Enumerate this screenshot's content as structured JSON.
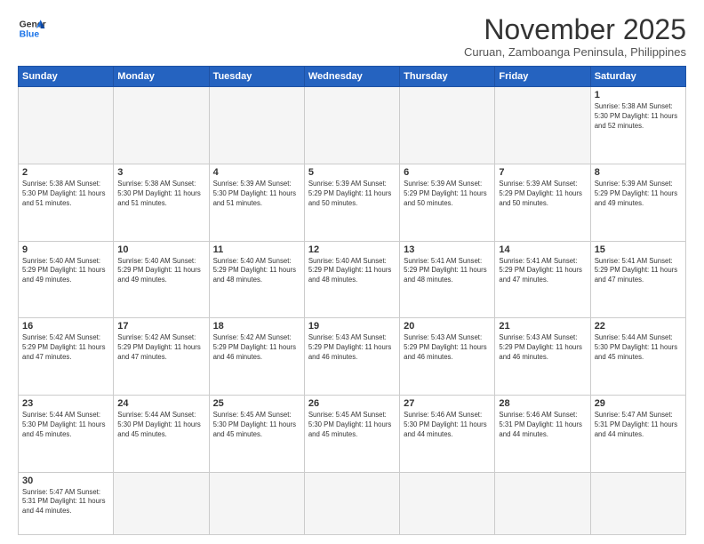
{
  "header": {
    "logo_line1": "General",
    "logo_line2": "Blue",
    "month_title": "November 2025",
    "subtitle": "Curuan, Zamboanga Peninsula, Philippines"
  },
  "days_of_week": [
    "Sunday",
    "Monday",
    "Tuesday",
    "Wednesday",
    "Thursday",
    "Friday",
    "Saturday"
  ],
  "weeks": [
    [
      {
        "day": "",
        "info": ""
      },
      {
        "day": "",
        "info": ""
      },
      {
        "day": "",
        "info": ""
      },
      {
        "day": "",
        "info": ""
      },
      {
        "day": "",
        "info": ""
      },
      {
        "day": "",
        "info": ""
      },
      {
        "day": "1",
        "info": "Sunrise: 5:38 AM\nSunset: 5:30 PM\nDaylight: 11 hours\nand 52 minutes."
      }
    ],
    [
      {
        "day": "2",
        "info": "Sunrise: 5:38 AM\nSunset: 5:30 PM\nDaylight: 11 hours\nand 51 minutes."
      },
      {
        "day": "3",
        "info": "Sunrise: 5:38 AM\nSunset: 5:30 PM\nDaylight: 11 hours\nand 51 minutes."
      },
      {
        "day": "4",
        "info": "Sunrise: 5:39 AM\nSunset: 5:30 PM\nDaylight: 11 hours\nand 51 minutes."
      },
      {
        "day": "5",
        "info": "Sunrise: 5:39 AM\nSunset: 5:29 PM\nDaylight: 11 hours\nand 50 minutes."
      },
      {
        "day": "6",
        "info": "Sunrise: 5:39 AM\nSunset: 5:29 PM\nDaylight: 11 hours\nand 50 minutes."
      },
      {
        "day": "7",
        "info": "Sunrise: 5:39 AM\nSunset: 5:29 PM\nDaylight: 11 hours\nand 50 minutes."
      },
      {
        "day": "8",
        "info": "Sunrise: 5:39 AM\nSunset: 5:29 PM\nDaylight: 11 hours\nand 49 minutes."
      }
    ],
    [
      {
        "day": "9",
        "info": "Sunrise: 5:40 AM\nSunset: 5:29 PM\nDaylight: 11 hours\nand 49 minutes."
      },
      {
        "day": "10",
        "info": "Sunrise: 5:40 AM\nSunset: 5:29 PM\nDaylight: 11 hours\nand 49 minutes."
      },
      {
        "day": "11",
        "info": "Sunrise: 5:40 AM\nSunset: 5:29 PM\nDaylight: 11 hours\nand 48 minutes."
      },
      {
        "day": "12",
        "info": "Sunrise: 5:40 AM\nSunset: 5:29 PM\nDaylight: 11 hours\nand 48 minutes."
      },
      {
        "day": "13",
        "info": "Sunrise: 5:41 AM\nSunset: 5:29 PM\nDaylight: 11 hours\nand 48 minutes."
      },
      {
        "day": "14",
        "info": "Sunrise: 5:41 AM\nSunset: 5:29 PM\nDaylight: 11 hours\nand 47 minutes."
      },
      {
        "day": "15",
        "info": "Sunrise: 5:41 AM\nSunset: 5:29 PM\nDaylight: 11 hours\nand 47 minutes."
      }
    ],
    [
      {
        "day": "16",
        "info": "Sunrise: 5:42 AM\nSunset: 5:29 PM\nDaylight: 11 hours\nand 47 minutes."
      },
      {
        "day": "17",
        "info": "Sunrise: 5:42 AM\nSunset: 5:29 PM\nDaylight: 11 hours\nand 47 minutes."
      },
      {
        "day": "18",
        "info": "Sunrise: 5:42 AM\nSunset: 5:29 PM\nDaylight: 11 hours\nand 46 minutes."
      },
      {
        "day": "19",
        "info": "Sunrise: 5:43 AM\nSunset: 5:29 PM\nDaylight: 11 hours\nand 46 minutes."
      },
      {
        "day": "20",
        "info": "Sunrise: 5:43 AM\nSunset: 5:29 PM\nDaylight: 11 hours\nand 46 minutes."
      },
      {
        "day": "21",
        "info": "Sunrise: 5:43 AM\nSunset: 5:29 PM\nDaylight: 11 hours\nand 46 minutes."
      },
      {
        "day": "22",
        "info": "Sunrise: 5:44 AM\nSunset: 5:30 PM\nDaylight: 11 hours\nand 45 minutes."
      }
    ],
    [
      {
        "day": "23",
        "info": "Sunrise: 5:44 AM\nSunset: 5:30 PM\nDaylight: 11 hours\nand 45 minutes."
      },
      {
        "day": "24",
        "info": "Sunrise: 5:44 AM\nSunset: 5:30 PM\nDaylight: 11 hours\nand 45 minutes."
      },
      {
        "day": "25",
        "info": "Sunrise: 5:45 AM\nSunset: 5:30 PM\nDaylight: 11 hours\nand 45 minutes."
      },
      {
        "day": "26",
        "info": "Sunrise: 5:45 AM\nSunset: 5:30 PM\nDaylight: 11 hours\nand 45 minutes."
      },
      {
        "day": "27",
        "info": "Sunrise: 5:46 AM\nSunset: 5:30 PM\nDaylight: 11 hours\nand 44 minutes."
      },
      {
        "day": "28",
        "info": "Sunrise: 5:46 AM\nSunset: 5:31 PM\nDaylight: 11 hours\nand 44 minutes."
      },
      {
        "day": "29",
        "info": "Sunrise: 5:47 AM\nSunset: 5:31 PM\nDaylight: 11 hours\nand 44 minutes."
      }
    ],
    [
      {
        "day": "30",
        "info": "Sunrise: 5:47 AM\nSunset: 5:31 PM\nDaylight: 11 hours\nand 44 minutes."
      },
      {
        "day": "",
        "info": ""
      },
      {
        "day": "",
        "info": ""
      },
      {
        "day": "",
        "info": ""
      },
      {
        "day": "",
        "info": ""
      },
      {
        "day": "",
        "info": ""
      },
      {
        "day": "",
        "info": ""
      }
    ]
  ]
}
